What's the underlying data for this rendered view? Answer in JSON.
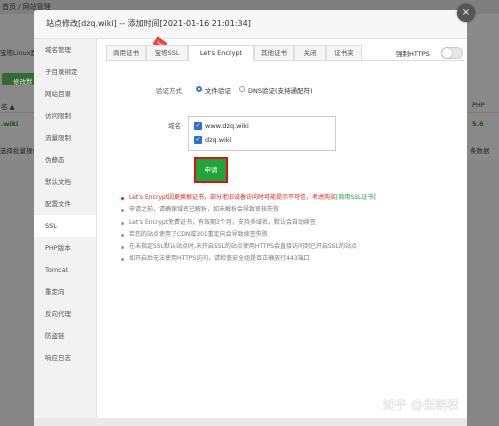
{
  "background": {
    "breadcrumb": "首页 / 网站管理",
    "left_text_1": "宝塔Linux面",
    "add_button": "修改默",
    "col_name": "名 ▲",
    "row_site": ".wiki",
    "row_hint": "选择批量操作",
    "col_php": "PHP",
    "php_version": "5.6",
    "count_text": "条数据"
  },
  "modal": {
    "title": "站点修改[dzq.wiki] -- 添加时间[2021-01-16 21:01:34]",
    "close_glyph": "×"
  },
  "sidebar": {
    "items": [
      {
        "label": "域名管理"
      },
      {
        "label": "子目录绑定"
      },
      {
        "label": "网站目录"
      },
      {
        "label": "访问限制"
      },
      {
        "label": "流量限制"
      },
      {
        "label": "伪静态"
      },
      {
        "label": "默认文档"
      },
      {
        "label": "配置文件"
      },
      {
        "label": "SSL"
      },
      {
        "label": "PHP版本"
      },
      {
        "label": "Tomcat"
      },
      {
        "label": "重定向"
      },
      {
        "label": "反向代理"
      },
      {
        "label": "防盗链"
      },
      {
        "label": "响应日志"
      }
    ],
    "active": "SSL"
  },
  "tabs": [
    {
      "label": "商用证书"
    },
    {
      "label": "宝塔SSL"
    },
    {
      "label": "Let's Encrypt"
    },
    {
      "label": "其他证书"
    },
    {
      "label": "关闭"
    },
    {
      "label": "证书夹"
    }
  ],
  "active_tab": "Let's Encrypt",
  "hot_badge": "hot",
  "force_https": {
    "label": "强制HTTPS",
    "enabled": false
  },
  "verify": {
    "label": "验证方式",
    "options": [
      {
        "label": "文件验证",
        "selected": true
      },
      {
        "label": "DNS验证(支持通配符)",
        "selected": false
      }
    ]
  },
  "domains": {
    "label": "域名",
    "items": [
      {
        "name": "www.dzq.wiki",
        "checked": true
      },
      {
        "name": "dzq.wiki",
        "checked": true
      }
    ]
  },
  "apply_button": "申请",
  "notes": {
    "warning": "Let's Encrypt因更换根证书，部分老旧设备访问时可能提示不可信，考虑购买",
    "warning_link": "[商用SSL证书]",
    "items": [
      "申请之前，请确保域名已解析，如未解析会导致审核失败",
      "Let's Encrypt免费证书，有效期3个月，支持多域名。默认会自动续签",
      "若您的站点使用了CDN或301重定向会导致续签失败",
      "在未指定SSL默认站点时,未开启SSL的站点使用HTTPS会直接访问到已开启SSL的站点",
      "如开启后无法使用HTTPS访问，请检查安全组是否正确放行443端口"
    ]
  },
  "watermark": "知乎 @张朝权",
  "colors": {
    "accent_green": "#20a53a",
    "warning_red": "#e0261b",
    "checkbox_blue": "#2f6fd1",
    "overlay_gray": "#8a8a8a"
  }
}
